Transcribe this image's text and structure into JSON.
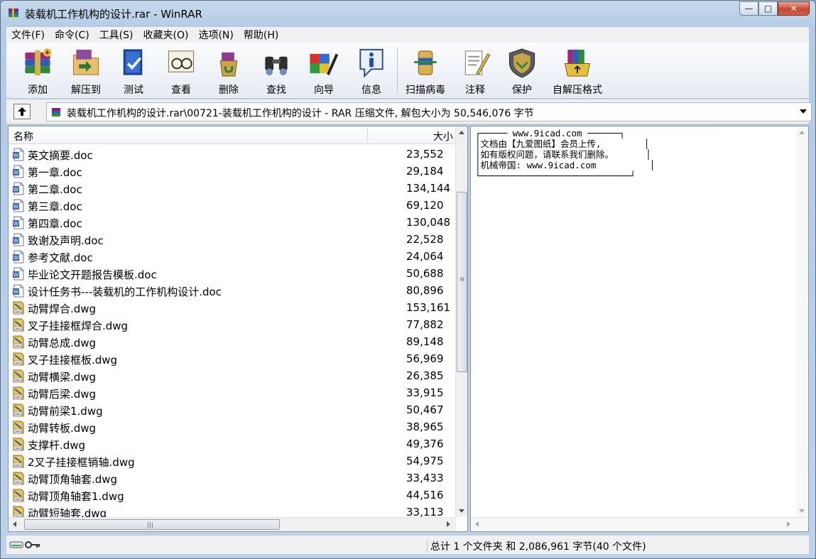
{
  "window": {
    "title": "装载机工作机构的设计.rar - WinRAR",
    "icon": "winrar-books-icon",
    "controls": {
      "minimize": "—",
      "maximize": "□",
      "close": "✕"
    }
  },
  "menu": [
    {
      "label": "文件(F)"
    },
    {
      "label": "命令(C)"
    },
    {
      "label": "工具(S)"
    },
    {
      "label": "收藏夹(O)"
    },
    {
      "label": "选项(N)"
    },
    {
      "label": "帮助(H)"
    }
  ],
  "toolbar": [
    {
      "label": "添加",
      "icon": "add-archive-icon"
    },
    {
      "label": "解压到",
      "icon": "extract-to-icon"
    },
    {
      "label": "测试",
      "icon": "test-icon"
    },
    {
      "label": "查看",
      "icon": "view-icon"
    },
    {
      "label": "删除",
      "icon": "delete-icon"
    },
    {
      "label": "查找",
      "icon": "find-icon"
    },
    {
      "label": "向导",
      "icon": "wizard-icon"
    },
    {
      "label": "信息",
      "icon": "info-icon"
    },
    {
      "label": "扫描病毒",
      "icon": "virus-scan-icon"
    },
    {
      "label": "注释",
      "icon": "comment-icon"
    },
    {
      "label": "保护",
      "icon": "protect-icon"
    },
    {
      "label": "自解压格式",
      "icon": "sfx-icon"
    }
  ],
  "address": {
    "path": "装载机工作机构的设计.rar\\00721-装载机工作机构的设计 - RAR 压缩文件, 解包大小为 50,546,076 字节"
  },
  "list": {
    "columns": {
      "name": "名称",
      "size": "大小"
    },
    "files": [
      {
        "name": "英文摘要.doc",
        "size": "23,552",
        "type": "doc"
      },
      {
        "name": "第一章.doc",
        "size": "29,184",
        "type": "doc"
      },
      {
        "name": "第二章.doc",
        "size": "134,144",
        "type": "doc"
      },
      {
        "name": "第三章.doc",
        "size": "69,120",
        "type": "doc"
      },
      {
        "name": "第四章.doc",
        "size": "130,048",
        "type": "doc"
      },
      {
        "name": "致谢及声明.doc",
        "size": "22,528",
        "type": "doc"
      },
      {
        "name": "参考文献.doc",
        "size": "24,064",
        "type": "doc"
      },
      {
        "name": "毕业论文开题报告模板.doc",
        "size": "50,688",
        "type": "doc"
      },
      {
        "name": "设计任务书---装载机的工作机构设计.doc",
        "size": "80,896",
        "type": "doc"
      },
      {
        "name": "动臂焊合.dwg",
        "size": "153,161",
        "type": "dwg"
      },
      {
        "name": "叉子挂接框焊合.dwg",
        "size": "77,882",
        "type": "dwg"
      },
      {
        "name": "动臂总成.dwg",
        "size": "89,148",
        "type": "dwg"
      },
      {
        "name": "叉子挂接框板.dwg",
        "size": "56,969",
        "type": "dwg"
      },
      {
        "name": "动臂横梁.dwg",
        "size": "26,385",
        "type": "dwg"
      },
      {
        "name": "动臂后梁.dwg",
        "size": "33,915",
        "type": "dwg"
      },
      {
        "name": "动臂前梁1.dwg",
        "size": "50,467",
        "type": "dwg"
      },
      {
        "name": "动臂转板.dwg",
        "size": "38,965",
        "type": "dwg"
      },
      {
        "name": "支撑杆.dwg",
        "size": "49,376",
        "type": "dwg"
      },
      {
        "name": "2叉子挂接框销轴.dwg",
        "size": "54,975",
        "type": "dwg"
      },
      {
        "name": "动臂顶角轴套.dwg",
        "size": "33,433",
        "type": "dwg"
      },
      {
        "name": "动臂顶角轴套1.dwg",
        "size": "44,516",
        "type": "dwg"
      },
      {
        "name": "动臂短轴套.dwg",
        "size": "33,113",
        "type": "dwg"
      }
    ]
  },
  "comment": {
    "lines": [
      "┌───── www.9icad.com ──────┐",
      "│文档由【九爱图纸】会员上传,        │",
      "│如有版权问题，请联系我们删除。      │",
      "│机械帝国: www.9icad.com          │",
      "└────────────────────────────┘"
    ]
  },
  "status": {
    "summary": "总计 1 个文件夹 和 2,086,961 字节(40 个文件)"
  }
}
